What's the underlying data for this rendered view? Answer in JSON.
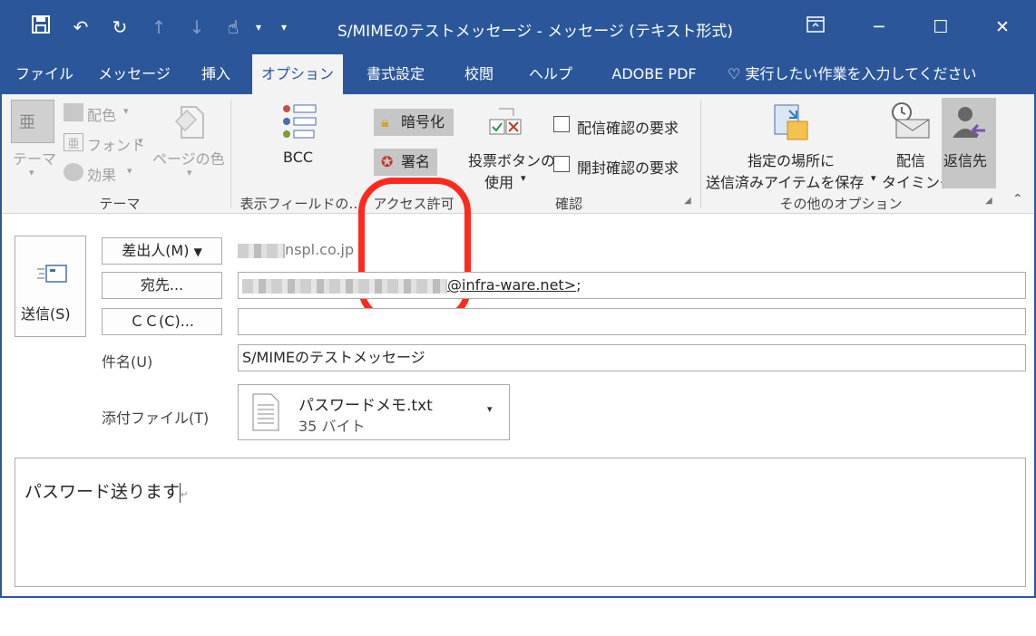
{
  "window": {
    "title": "S/MIMEのテストメッセージ  -  メッセージ (テキスト形式)"
  },
  "qat": {
    "save_icon": "save-icon",
    "undo_icon": "undo-icon",
    "redo_icon": "redo-icon",
    "up_icon": "arrow-up-icon",
    "down_icon": "arrow-down-icon",
    "touch_icon": "touch-mode-icon",
    "customize_icon": "customize-qat-icon"
  },
  "tabs": [
    {
      "label": "ファイル"
    },
    {
      "label": "メッセージ"
    },
    {
      "label": "挿入"
    },
    {
      "label": "オプション"
    },
    {
      "label": "書式設定"
    },
    {
      "label": "校閲"
    },
    {
      "label": "ヘルプ"
    },
    {
      "label": "ADOBE PDF"
    }
  ],
  "tellme": {
    "label": "実行したい作業を入力してください"
  },
  "ribbon": {
    "theme": {
      "theme_label": "テーマ",
      "colors_label": "配色",
      "fonts_label": "フォント",
      "effects_label": "効果",
      "page_color_label": "ページの色",
      "group_label": "テーマ"
    },
    "fields": {
      "bcc_label": "BCC",
      "group_label": "表示フィールドの…"
    },
    "permission": {
      "encrypt_label": "暗号化",
      "sign_label": "署名",
      "group_label": "アクセス許可"
    },
    "tracking": {
      "voting_label_1": "投票ボタンの",
      "voting_label_2": "使用",
      "delivery_receipt_label": "配信確認の要求",
      "read_receipt_label": "開封確認の要求",
      "group_label": "確認"
    },
    "more": {
      "save_sent_label_1": "指定の場所に",
      "save_sent_label_2": "送信済みアイテムを保存",
      "delay_label_1": "配信",
      "delay_label_2": "タイミング",
      "reply_to_label": "返信先",
      "group_label": "その他のオプション"
    }
  },
  "compose": {
    "send_label": "送信(S)",
    "from_button": "差出人(M)",
    "from_value_suffix": "nspl.co.jp",
    "to_button": "宛先...",
    "to_value_suffix": "@infra-ware.net>",
    "to_value_tail": ";",
    "cc_button": "ＣＣ(C)...",
    "subject_label": "件名(U)",
    "subject_value": "S/MIMEのテストメッセージ",
    "attach_label": "添付ファイル(T)",
    "attachment_name": "パスワードメモ.txt",
    "attachment_size": "35 バイト",
    "body_text": "パスワード送ります"
  },
  "colors": {
    "accent": "#2b579a",
    "highlight_ring": "#ff2a1c"
  }
}
